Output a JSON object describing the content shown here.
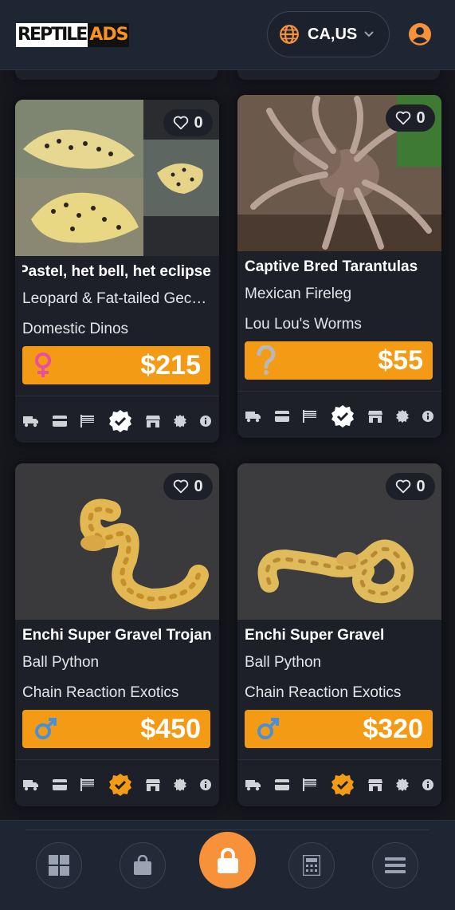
{
  "header": {
    "logo_left": "REPTILE",
    "logo_right": "ADS",
    "region": "CA,US"
  },
  "listings": [
    {
      "title": "Pastel, het bell, het eclipse",
      "species": "Leopard & Fat-tailed Geckos",
      "seller": "Domestic Dinos",
      "price": "$215",
      "sex": "female",
      "likes": "0",
      "verified_color": "#ffffff"
    },
    {
      "title": "Captive Bred Tarantulas",
      "species": "Mexican Fireleg",
      "seller": "Lou Lou's Worms",
      "price": "$55",
      "sex": "unknown",
      "likes": "0",
      "verified_color": "#ffffff"
    },
    {
      "title": "Enchi Super Gravel Trojan",
      "species": "Ball Python",
      "seller": "Chain Reaction Exotics",
      "price": "$450",
      "sex": "male",
      "likes": "0",
      "verified_color": "#f49b15"
    },
    {
      "title": "Enchi Super Gravel",
      "species": "Ball Python",
      "seller": "Chain Reaction Exotics",
      "price": "$320",
      "sex": "male",
      "likes": "0",
      "verified_color": "#f49b15"
    }
  ],
  "listing_icons": [
    "truck-icon",
    "card-icon",
    "flag-icon",
    "verified-badge-icon",
    "store-icon",
    "seal-icon",
    "info-icon"
  ],
  "nav": [
    "grid-icon",
    "shopping-bag-icon",
    "lock-icon",
    "calculator-icon",
    "menu-icon"
  ],
  "colors": {
    "accent": "#f49b15",
    "female": "#e8509c",
    "male": "#4a90d9",
    "unknown": "#b8b8bc"
  }
}
